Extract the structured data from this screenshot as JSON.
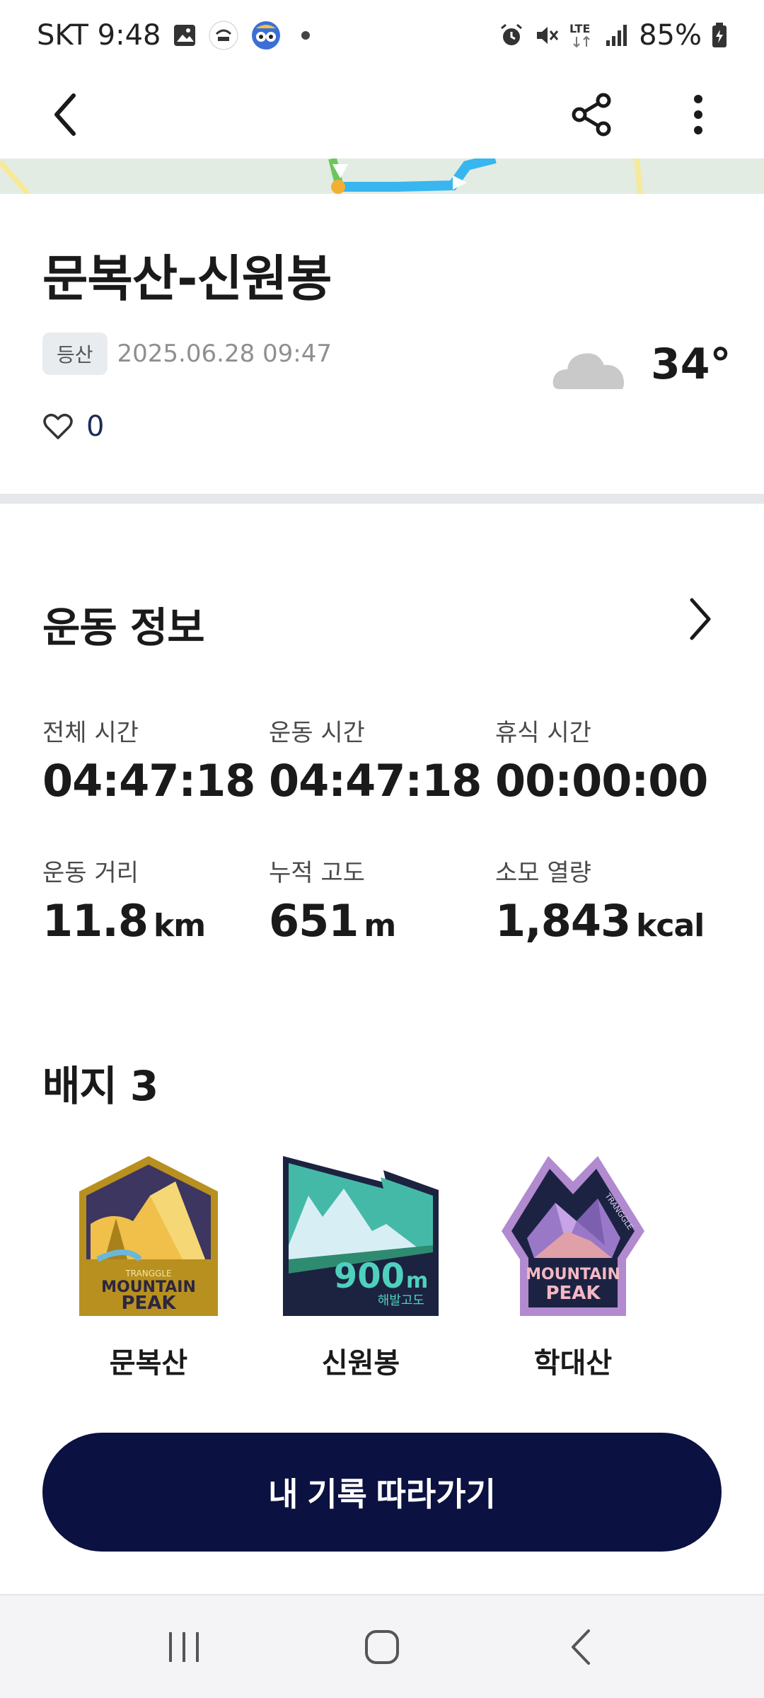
{
  "status_bar": {
    "carrier_time": "SKT 9:48",
    "network": "LTE",
    "battery": "85%",
    "icons": [
      "gallery-icon",
      "sol-bank-icon",
      "owl-app-icon",
      "notification-dot",
      "alarm-icon",
      "mute-icon",
      "lte-icon",
      "signal-icon",
      "battery-icon"
    ]
  },
  "app_bar": {
    "icons": [
      "back-icon",
      "share-icon",
      "more-vert-icon"
    ]
  },
  "record": {
    "title": "문복산-신원봉",
    "tag": "등산",
    "datetime": "2025.06.28 09:47",
    "weather_icon": "cloud-icon",
    "temperature": "34°",
    "like_count": "0"
  },
  "exercise": {
    "section_title": "운동 정보",
    "stats": [
      {
        "label": "전체 시간",
        "value": "04:47:18",
        "unit": ""
      },
      {
        "label": "운동 시간",
        "value": "04:47:18",
        "unit": ""
      },
      {
        "label": "휴식 시간",
        "value": "00:00:00",
        "unit": ""
      },
      {
        "label": "운동 거리",
        "value": "11.8",
        "unit": "km"
      },
      {
        "label": "누적 고도",
        "value": "651",
        "unit": "m"
      },
      {
        "label": "소모 열량",
        "value": "1,843",
        "unit": "kcal"
      }
    ]
  },
  "badges": {
    "section_title": "배지 3",
    "items": [
      {
        "name": "문복산",
        "art_brand": "TRANGGLE",
        "art_line1": "MOUNTAIN",
        "art_line2": "PEAK"
      },
      {
        "name": "신원봉",
        "art_value": "900",
        "art_unit": "m",
        "art_caption": "해발고도"
      },
      {
        "name": "학대산",
        "art_brand": "TRANGGLE",
        "art_line1": "MOUNTAIN",
        "art_line2": "PEAK"
      }
    ]
  },
  "cta": {
    "label": "내 기록 따라가기"
  },
  "colors": {
    "primary_navy": "#0b1140",
    "divider": "#e6e7ea",
    "badge_gold": "#b8901f",
    "badge_teal": "#3fc0b0",
    "badge_purple": "#b28ad0"
  }
}
